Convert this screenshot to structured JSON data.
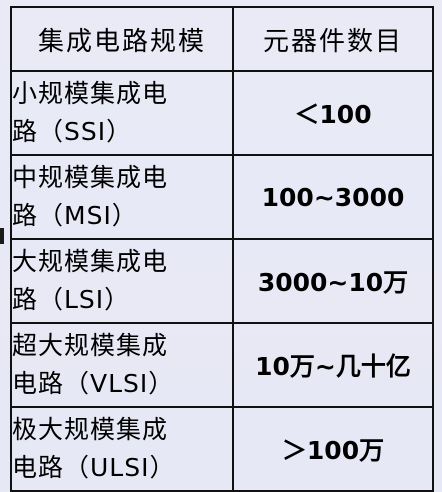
{
  "table": {
    "headers": [
      "集成电路规模",
      "元器件数目"
    ],
    "rows": [
      {
        "name_line1": "小规模集成电",
        "name_line2": "路（SSI）",
        "count": "＜100"
      },
      {
        "name_line1": "中规模集成电",
        "name_line2": "路（MSI）",
        "count": "100~3000"
      },
      {
        "name_line1": "大规模集成电",
        "name_line2": "路（LSI）",
        "count": "3000~10万"
      },
      {
        "name_line1": "超大规模集成",
        "name_line2": "电路（VLSI）",
        "count": "10万~几十亿"
      },
      {
        "name_line1": "极大规模集成",
        "name_line2": "电路（ULSI）",
        "count": "＞100万"
      }
    ]
  }
}
